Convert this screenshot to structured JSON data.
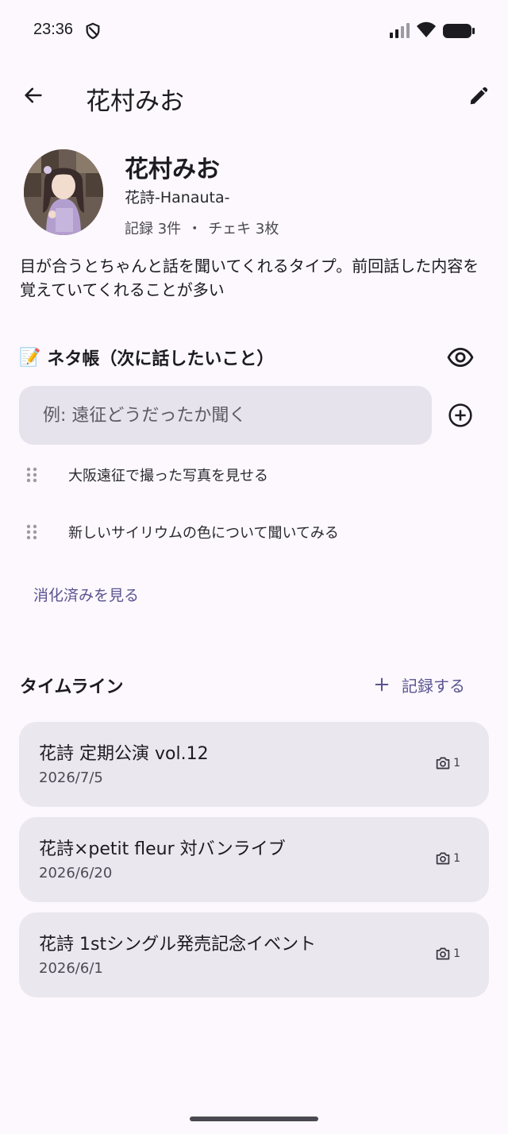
{
  "status_bar": {
    "time": "23:36",
    "icons": [
      "shield-icon",
      "signal-icon",
      "wifi-icon",
      "battery-icon"
    ]
  },
  "app_bar": {
    "title": "花村みお",
    "back_icon": "arrow-back-icon",
    "edit_icon": "edit-pencil-icon"
  },
  "profile": {
    "name": "花村みお",
    "group": "花詩-Hanauta-",
    "records": "記録 3件",
    "separator": "・",
    "cheki": "チェキ 3枚",
    "note": "目が合うとちゃんと話を聞いてくれるタイプ。前回話した内容を覚えていてくれることが多い"
  },
  "neta": {
    "emoji": "📝",
    "title": "ネタ帳（次に話したいこと）",
    "input_placeholder": "例: 遠征どうだったか聞く",
    "input_value": "",
    "items": [
      {
        "text": "大阪遠征で撮った写真を見せる"
      },
      {
        "text": "新しいサイリウムの色について聞いてみる"
      }
    ],
    "done_link": "消化済みを見る"
  },
  "timeline": {
    "title": "タイムライン",
    "record_button": "記録する",
    "entries": [
      {
        "title": "花詩 定期公演 vol.12",
        "date": "2026/7/5",
        "photos": "1"
      },
      {
        "title": "花詩×petit fleur 対バンライブ",
        "date": "2026/6/20",
        "photos": "1"
      },
      {
        "title": "花詩 1stシングル発売記念イベント",
        "date": "2026/6/1",
        "photos": "1"
      }
    ]
  },
  "colors": {
    "background": "#fcf8fd",
    "accent": "#5a5490",
    "card": "#ebe7ef",
    "input": "#e7e3ec"
  }
}
